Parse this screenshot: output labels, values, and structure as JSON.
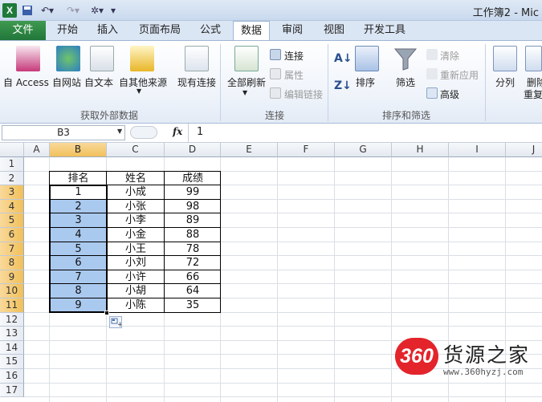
{
  "titlebar": {
    "title": "工作簿2 - Mic"
  },
  "tabs": [
    "文件",
    "开始",
    "插入",
    "页面布局",
    "公式",
    "数据",
    "审阅",
    "视图",
    "开发工具"
  ],
  "ribbon": {
    "get_external": {
      "access": "自 Access",
      "web": "自网站",
      "text": "自文本",
      "other": "自其他来源",
      "existing": "现有连接",
      "label": "获取外部数据"
    },
    "connections": {
      "refresh_all": "全部刷新",
      "connections": "连接",
      "properties": "属性",
      "edit_links": "编辑链接",
      "label": "连接"
    },
    "sort_filter": {
      "sort": "排序",
      "filter": "筛选",
      "clear": "清除",
      "reapply": "重新应用",
      "advanced": "高级",
      "label": "排序和筛选"
    },
    "data_tools": {
      "split": "分列",
      "remove": "删除",
      "repeat": "重复"
    }
  },
  "formula_bar": {
    "name_box": "B3",
    "fx": "fx",
    "value": "1"
  },
  "grid": {
    "columns": [
      "A",
      "B",
      "C",
      "D",
      "E",
      "F",
      "G",
      "H",
      "I",
      "J"
    ],
    "rows": [
      "1",
      "2",
      "3",
      "4",
      "5",
      "6",
      "7",
      "8",
      "9",
      "10",
      "11",
      "12",
      "13",
      "14",
      "15",
      "16",
      "17"
    ],
    "headers": [
      "排名",
      "姓名",
      "成绩"
    ],
    "data": [
      [
        "1",
        "小成",
        "99"
      ],
      [
        "2",
        "小张",
        "98"
      ],
      [
        "3",
        "小李",
        "89"
      ],
      [
        "4",
        "小金",
        "88"
      ],
      [
        "5",
        "小王",
        "78"
      ],
      [
        "6",
        "小刘",
        "72"
      ],
      [
        "7",
        "小许",
        "66"
      ],
      [
        "8",
        "小胡",
        "64"
      ],
      [
        "9",
        "小陈",
        "35"
      ]
    ]
  },
  "watermark": {
    "badge": "360",
    "name": "货源之家",
    "url": "www.360hyzj.com"
  },
  "colors": {
    "selection": "#aac9ef",
    "header_selected": "#f1c05a",
    "file_tab": "#21763a"
  }
}
